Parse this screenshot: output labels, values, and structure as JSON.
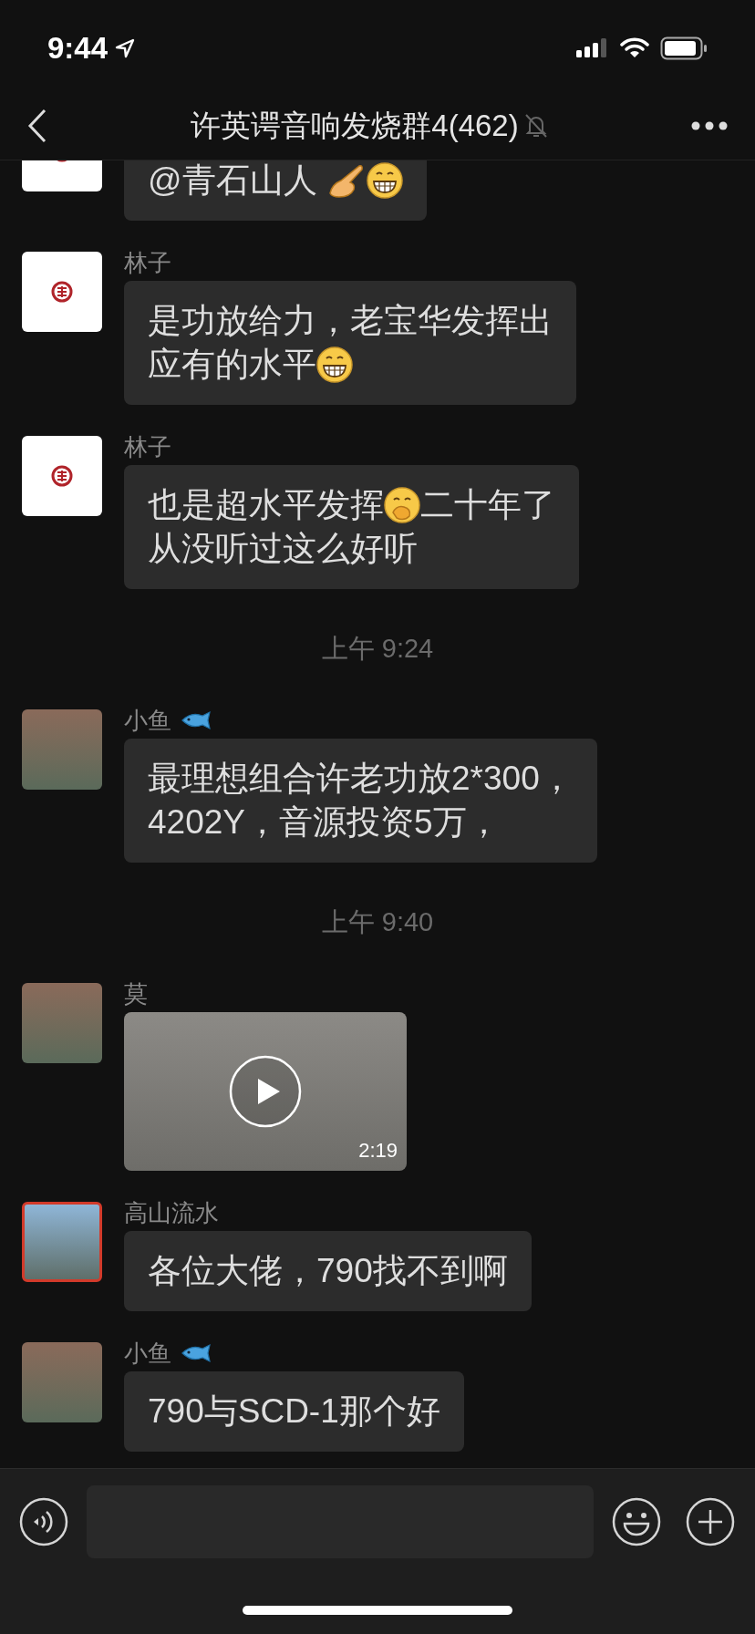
{
  "status_bar": {
    "time": "9:44"
  },
  "header": {
    "title": "许英谔音响发烧群4(462)",
    "muted": true
  },
  "chat": [
    {
      "kind": "text",
      "avatar": {
        "kind": "logo"
      },
      "lines": [
        [
          {
            "kind": "text",
            "text": "@青石山人 "
          },
          {
            "kind": "pinch-emoji"
          },
          {
            "kind": "grin-emoji"
          }
        ]
      ]
    },
    {
      "kind": "text",
      "avatar": {
        "kind": "logo"
      },
      "sender": "林子",
      "lines": [
        [
          {
            "kind": "text",
            "text": "是功放给力，老宝华发挥出"
          }
        ],
        [
          {
            "kind": "text",
            "text": "应有的水平"
          },
          {
            "kind": "grin-emoji"
          }
        ]
      ]
    },
    {
      "kind": "text",
      "avatar": {
        "kind": "logo"
      },
      "sender": "林子",
      "lines": [
        [
          {
            "kind": "text",
            "text": "也是超水平发挥"
          },
          {
            "kind": "thinking-emoji"
          },
          {
            "kind": "text",
            "text": "二十年了"
          }
        ],
        [
          {
            "kind": "text",
            "text": "从没听过这么好听"
          }
        ]
      ]
    },
    {
      "kind": "time",
      "text": "上午 9:24"
    },
    {
      "kind": "text",
      "avatar": {
        "kind": "photo",
        "framed": false
      },
      "sender": "小鱼",
      "name_fish": true,
      "lines": [
        [
          {
            "kind": "text",
            "text": "最理想组合许老功放2*300，"
          }
        ],
        [
          {
            "kind": "text",
            "text": "4202Y，音源投资5万，"
          }
        ]
      ]
    },
    {
      "kind": "time",
      "text": "上午 9:40"
    },
    {
      "kind": "video",
      "avatar": {
        "kind": "photo",
        "framed": false
      },
      "sender": "莫",
      "duration": "2:19"
    },
    {
      "kind": "text",
      "avatar": {
        "kind": "photo",
        "framed": true
      },
      "sender": "高山流水",
      "lines": [
        [
          {
            "kind": "text",
            "text": "各位大佬，790找不到啊"
          }
        ]
      ]
    },
    {
      "kind": "text",
      "avatar": {
        "kind": "photo",
        "framed": false
      },
      "sender": "小鱼",
      "name_fish": true,
      "lines": [
        [
          {
            "kind": "text",
            "text": "790与SCD-1那个好"
          }
        ]
      ]
    }
  ]
}
